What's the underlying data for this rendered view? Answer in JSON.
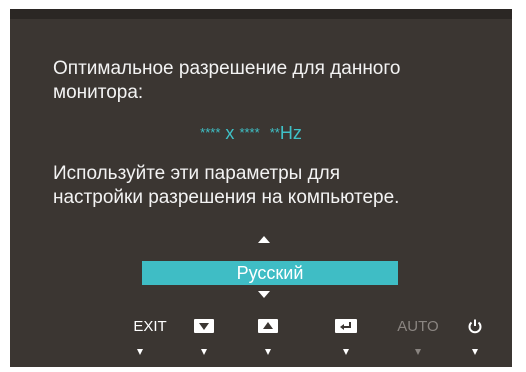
{
  "message": {
    "line1": "Оптимальное разрешение для данного",
    "line2": "монитора:",
    "line3": "Используйте эти параметры для",
    "line4": "настройки разрешения на компьютере."
  },
  "resolution": {
    "width_mask": "****",
    "sep": " x ",
    "height_mask": "****",
    "hz_mask": "**",
    "hz_unit": "Hz"
  },
  "language": {
    "selected": "Русский"
  },
  "keys": {
    "exit_label": "EXIT",
    "auto_label": "AUTO",
    "down_icon": "down-arrow-icon",
    "up_icon": "up-arrow-icon",
    "enter_icon": "enter-icon",
    "power_icon": "power-icon"
  },
  "colors": {
    "background": "#3b3632",
    "accent": "#3fbdc5",
    "resolution_text": "#3fc1c7",
    "disabled": "#8a8581"
  }
}
